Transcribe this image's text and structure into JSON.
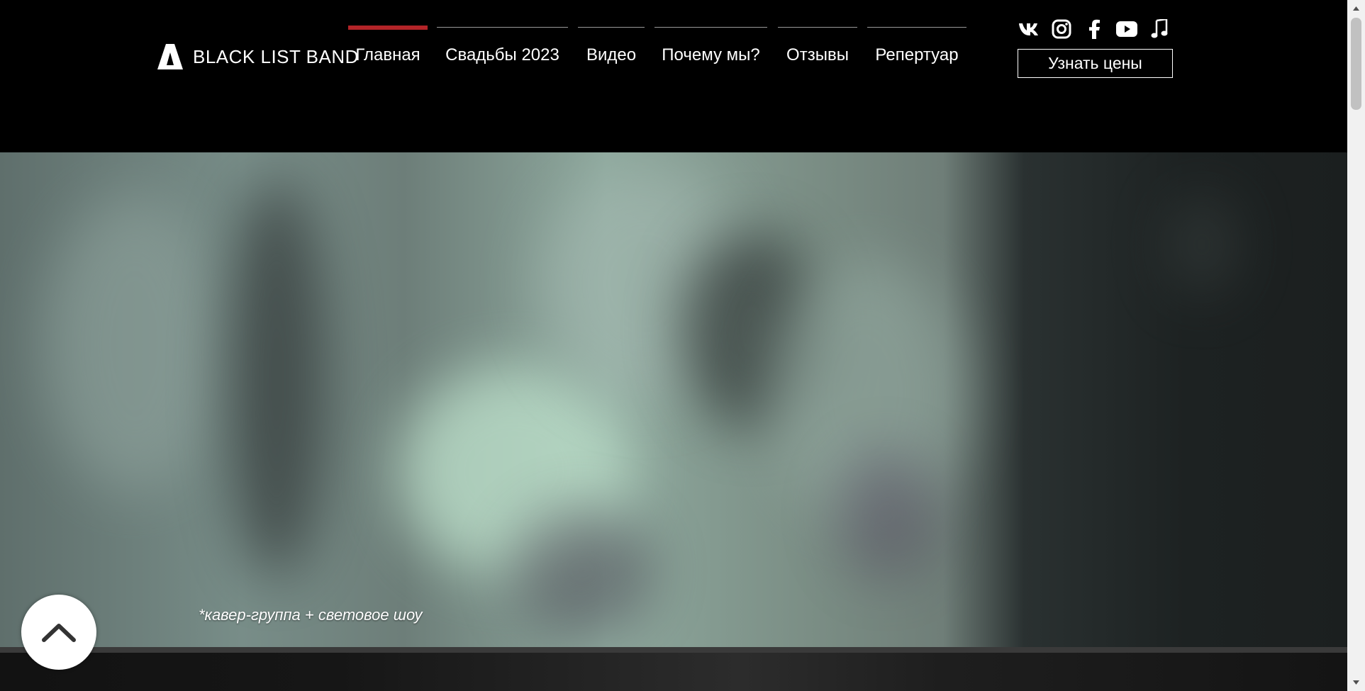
{
  "brand": {
    "name": "BLACK LIST BAND"
  },
  "nav": {
    "items": [
      {
        "label": "Главная",
        "active": true
      },
      {
        "label": "Свадьбы 2023",
        "active": false
      },
      {
        "label": "Видео",
        "active": false
      },
      {
        "label": "Почему мы?",
        "active": false
      },
      {
        "label": "Отзывы",
        "active": false
      },
      {
        "label": "Репертуар",
        "active": false
      }
    ]
  },
  "socials": [
    "vk-icon",
    "instagram-icon",
    "facebook-icon",
    "youtube-icon",
    "music-note-icon"
  ],
  "header": {
    "cta_label": "Узнать цены"
  },
  "hero": {
    "caption": "*кавер-группа + световое шоу"
  },
  "colors": {
    "accent": "#b32428",
    "background": "#000000",
    "text": "#ffffff"
  }
}
